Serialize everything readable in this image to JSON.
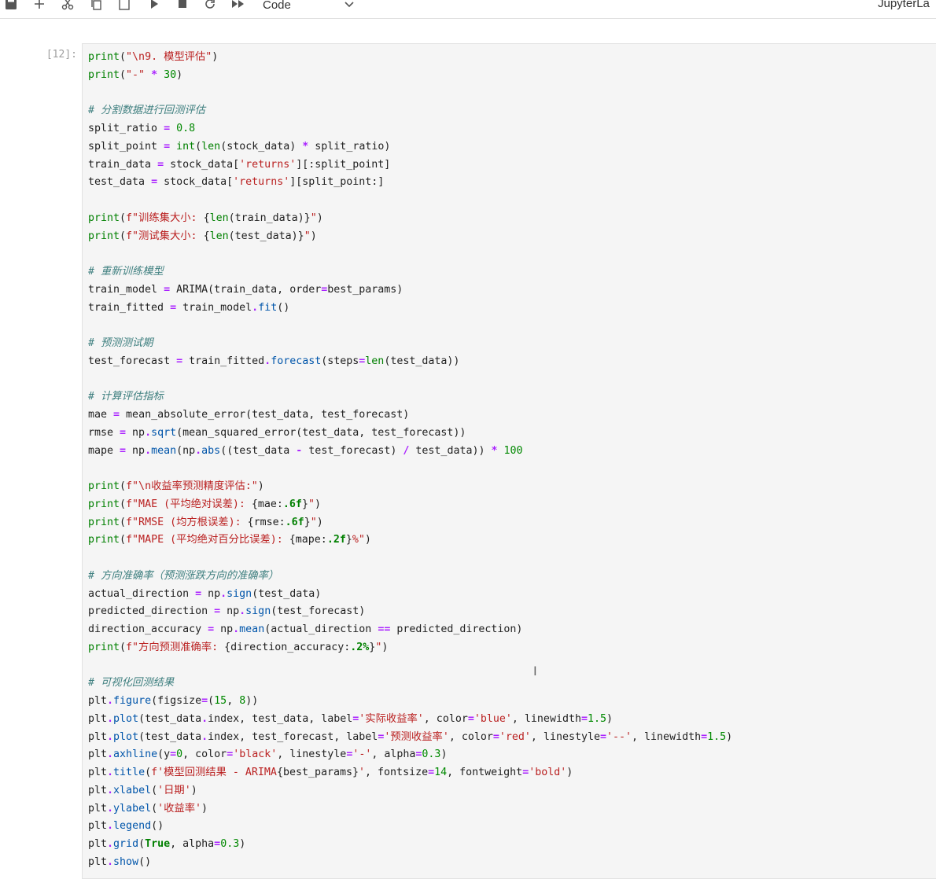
{
  "toolbar": {
    "cell_type": "Code",
    "brand": "JupyterLa"
  },
  "cell": {
    "prompt": "[12]:",
    "lines": [
      [
        [
          "k",
          "print"
        ],
        [
          "",
          "("
        ],
        [
          "s",
          "\"\\n9. 模型评估\""
        ],
        [
          "",
          ")"
        ]
      ],
      [
        [
          "k",
          "print"
        ],
        [
          "",
          "("
        ],
        [
          "s",
          "\"-\""
        ],
        [
          "",
          " "
        ],
        [
          "o",
          "*"
        ],
        [
          "",
          " "
        ],
        [
          "n",
          "30"
        ],
        [
          "",
          ")"
        ]
      ],
      [],
      [
        [
          "c",
          "# 分割数据进行回测评估"
        ]
      ],
      [
        [
          "",
          "split_ratio "
        ],
        [
          "o",
          "="
        ],
        [
          "",
          " "
        ],
        [
          "n",
          "0.8"
        ]
      ],
      [
        [
          "",
          "split_point "
        ],
        [
          "o",
          "="
        ],
        [
          "",
          " "
        ],
        [
          "k",
          "int"
        ],
        [
          "",
          "("
        ],
        [
          "k",
          "len"
        ],
        [
          "",
          "(stock_data) "
        ],
        [
          "o",
          "*"
        ],
        [
          "",
          " split_ratio)"
        ]
      ],
      [
        [
          "",
          "train_data "
        ],
        [
          "o",
          "="
        ],
        [
          "",
          " stock_data["
        ],
        [
          "s",
          "'returns'"
        ],
        [
          "",
          "][:split_point]"
        ]
      ],
      [
        [
          "",
          "test_data "
        ],
        [
          "o",
          "="
        ],
        [
          "",
          " stock_data["
        ],
        [
          "s",
          "'returns'"
        ],
        [
          "",
          "][split_point:]"
        ]
      ],
      [],
      [
        [
          "k",
          "print"
        ],
        [
          "",
          "("
        ],
        [
          "s",
          "f\"训练集大小: "
        ],
        [
          "",
          "{"
        ],
        [
          "k",
          "len"
        ],
        [
          "",
          "(train_data)}"
        ],
        [
          "s",
          "\""
        ],
        [
          "",
          ")"
        ]
      ],
      [
        [
          "k",
          "print"
        ],
        [
          "",
          "("
        ],
        [
          "s",
          "f\"测试集大小: "
        ],
        [
          "",
          "{"
        ],
        [
          "k",
          "len"
        ],
        [
          "",
          "(test_data)}"
        ],
        [
          "s",
          "\""
        ],
        [
          "",
          ")"
        ]
      ],
      [],
      [
        [
          "c",
          "# 重新训练模型"
        ]
      ],
      [
        [
          "",
          "train_model "
        ],
        [
          "o",
          "="
        ],
        [
          "",
          " ARIMA(train_data, order"
        ],
        [
          "o",
          "="
        ],
        [
          "",
          "best_params)"
        ]
      ],
      [
        [
          "",
          "train_fitted "
        ],
        [
          "o",
          "="
        ],
        [
          "",
          " train_model"
        ],
        [
          "o",
          "."
        ],
        [
          "a",
          "fit"
        ],
        [
          "",
          "()"
        ]
      ],
      [],
      [
        [
          "c",
          "# 预测测试期"
        ]
      ],
      [
        [
          "",
          "test_forecast "
        ],
        [
          "o",
          "="
        ],
        [
          "",
          " train_fitted"
        ],
        [
          "o",
          "."
        ],
        [
          "a",
          "forecast"
        ],
        [
          "",
          "(steps"
        ],
        [
          "o",
          "="
        ],
        [
          "k",
          "len"
        ],
        [
          "",
          "(test_data))"
        ]
      ],
      [],
      [
        [
          "c",
          "# 计算评估指标"
        ]
      ],
      [
        [
          "",
          "mae "
        ],
        [
          "o",
          "="
        ],
        [
          "",
          " mean_absolute_error(test_data, test_forecast)"
        ]
      ],
      [
        [
          "",
          "rmse "
        ],
        [
          "o",
          "="
        ],
        [
          "",
          " np"
        ],
        [
          "o",
          "."
        ],
        [
          "a",
          "sqrt"
        ],
        [
          "",
          "(mean_squared_error(test_data, test_forecast))"
        ]
      ],
      [
        [
          "",
          "mape "
        ],
        [
          "o",
          "="
        ],
        [
          "",
          " np"
        ],
        [
          "o",
          "."
        ],
        [
          "a",
          "mean"
        ],
        [
          "",
          "(np"
        ],
        [
          "o",
          "."
        ],
        [
          "a",
          "abs"
        ],
        [
          "",
          "((test_data "
        ],
        [
          "o",
          "-"
        ],
        [
          "",
          " test_forecast) "
        ],
        [
          "o",
          "/"
        ],
        [
          "",
          " test_data)) "
        ],
        [
          "o",
          "*"
        ],
        [
          "",
          " "
        ],
        [
          "n",
          "100"
        ]
      ],
      [],
      [
        [
          "k",
          "print"
        ],
        [
          "",
          "("
        ],
        [
          "s",
          "f\"\\n收益率预测精度评估:\""
        ],
        [
          "",
          ")"
        ]
      ],
      [
        [
          "k",
          "print"
        ],
        [
          "",
          "("
        ],
        [
          "s",
          "f\"MAE (平均绝对误差): "
        ],
        [
          "",
          "{mae:"
        ],
        [
          "b",
          ".6f"
        ],
        [
          "",
          "}"
        ],
        [
          "s",
          "\""
        ],
        [
          "",
          ")"
        ]
      ],
      [
        [
          "k",
          "print"
        ],
        [
          "",
          "("
        ],
        [
          "s",
          "f\"RMSE (均方根误差): "
        ],
        [
          "",
          "{rmse:"
        ],
        [
          "b",
          ".6f"
        ],
        [
          "",
          "}"
        ],
        [
          "s",
          "\""
        ],
        [
          "",
          ")"
        ]
      ],
      [
        [
          "k",
          "print"
        ],
        [
          "",
          "("
        ],
        [
          "s",
          "f\"MAPE (平均绝对百分比误差): "
        ],
        [
          "",
          "{mape:"
        ],
        [
          "b",
          ".2f"
        ],
        [
          "",
          "}"
        ],
        [
          "s",
          "%\""
        ],
        [
          "",
          ")"
        ]
      ],
      [],
      [
        [
          "c",
          "# 方向准确率（预测涨跌方向的准确率）"
        ]
      ],
      [
        [
          "",
          "actual_direction "
        ],
        [
          "o",
          "="
        ],
        [
          "",
          " np"
        ],
        [
          "o",
          "."
        ],
        [
          "a",
          "sign"
        ],
        [
          "",
          "(test_data)"
        ]
      ],
      [
        [
          "",
          "predicted_direction "
        ],
        [
          "o",
          "="
        ],
        [
          "",
          " np"
        ],
        [
          "o",
          "."
        ],
        [
          "a",
          "sign"
        ],
        [
          "",
          "(test_forecast)"
        ]
      ],
      [
        [
          "",
          "direction_accuracy "
        ],
        [
          "o",
          "="
        ],
        [
          "",
          " np"
        ],
        [
          "o",
          "."
        ],
        [
          "a",
          "mean"
        ],
        [
          "",
          "(actual_direction "
        ],
        [
          "o",
          "=="
        ],
        [
          "",
          " predicted_direction)"
        ]
      ],
      [
        [
          "k",
          "print"
        ],
        [
          "",
          "("
        ],
        [
          "s",
          "f\"方向预测准确率: "
        ],
        [
          "",
          "{direction_accuracy:"
        ],
        [
          "b",
          ".2%"
        ],
        [
          "",
          "}"
        ],
        [
          "s",
          "\""
        ],
        [
          "",
          ")"
        ]
      ],
      [],
      [
        [
          "c",
          "# 可视化回测结果"
        ]
      ],
      [
        [
          "",
          "plt"
        ],
        [
          "o",
          "."
        ],
        [
          "a",
          "figure"
        ],
        [
          "",
          "(figsize"
        ],
        [
          "o",
          "="
        ],
        [
          "",
          "("
        ],
        [
          "n",
          "15"
        ],
        [
          "",
          ", "
        ],
        [
          "n",
          "8"
        ],
        [
          "",
          "))"
        ]
      ],
      [
        [
          "",
          "plt"
        ],
        [
          "o",
          "."
        ],
        [
          "a",
          "plot"
        ],
        [
          "",
          "(test_data"
        ],
        [
          "o",
          "."
        ],
        [
          "",
          "index, test_data, label"
        ],
        [
          "o",
          "="
        ],
        [
          "s",
          "'实际收益率'"
        ],
        [
          "",
          ", color"
        ],
        [
          "o",
          "="
        ],
        [
          "s",
          "'blue'"
        ],
        [
          "",
          ", linewidth"
        ],
        [
          "o",
          "="
        ],
        [
          "n",
          "1.5"
        ],
        [
          "",
          ")"
        ]
      ],
      [
        [
          "",
          "plt"
        ],
        [
          "o",
          "."
        ],
        [
          "a",
          "plot"
        ],
        [
          "",
          "(test_data"
        ],
        [
          "o",
          "."
        ],
        [
          "",
          "index, test_forecast, label"
        ],
        [
          "o",
          "="
        ],
        [
          "s",
          "'预测收益率'"
        ],
        [
          "",
          ", color"
        ],
        [
          "o",
          "="
        ],
        [
          "s",
          "'red'"
        ],
        [
          "",
          ", linestyle"
        ],
        [
          "o",
          "="
        ],
        [
          "s",
          "'--'"
        ],
        [
          "",
          ", linewidth"
        ],
        [
          "o",
          "="
        ],
        [
          "n",
          "1.5"
        ],
        [
          "",
          ")"
        ]
      ],
      [
        [
          "",
          "plt"
        ],
        [
          "o",
          "."
        ],
        [
          "a",
          "axhline"
        ],
        [
          "",
          "(y"
        ],
        [
          "o",
          "="
        ],
        [
          "n",
          "0"
        ],
        [
          "",
          ", color"
        ],
        [
          "o",
          "="
        ],
        [
          "s",
          "'black'"
        ],
        [
          "",
          ", linestyle"
        ],
        [
          "o",
          "="
        ],
        [
          "s",
          "'-'"
        ],
        [
          "",
          ", alpha"
        ],
        [
          "o",
          "="
        ],
        [
          "n",
          "0.3"
        ],
        [
          "",
          ")"
        ]
      ],
      [
        [
          "",
          "plt"
        ],
        [
          "o",
          "."
        ],
        [
          "a",
          "title"
        ],
        [
          "",
          "("
        ],
        [
          "s",
          "f'模型回测结果 - ARIMA"
        ],
        [
          "",
          "{best_params}"
        ],
        [
          "s",
          "'"
        ],
        [
          "",
          ", fontsize"
        ],
        [
          "o",
          "="
        ],
        [
          "n",
          "14"
        ],
        [
          "",
          ", fontweight"
        ],
        [
          "o",
          "="
        ],
        [
          "s",
          "'bold'"
        ],
        [
          "",
          ")"
        ]
      ],
      [
        [
          "",
          "plt"
        ],
        [
          "o",
          "."
        ],
        [
          "a",
          "xlabel"
        ],
        [
          "",
          "("
        ],
        [
          "s",
          "'日期'"
        ],
        [
          "",
          ")"
        ]
      ],
      [
        [
          "",
          "plt"
        ],
        [
          "o",
          "."
        ],
        [
          "a",
          "ylabel"
        ],
        [
          "",
          "("
        ],
        [
          "s",
          "'收益率'"
        ],
        [
          "",
          ")"
        ]
      ],
      [
        [
          "",
          "plt"
        ],
        [
          "o",
          "."
        ],
        [
          "a",
          "legend"
        ],
        [
          "",
          "()"
        ]
      ],
      [
        [
          "",
          "plt"
        ],
        [
          "o",
          "."
        ],
        [
          "a",
          "grid"
        ],
        [
          "",
          "("
        ],
        [
          "b",
          "True"
        ],
        [
          "",
          ", alpha"
        ],
        [
          "o",
          "="
        ],
        [
          "n",
          "0.3"
        ],
        [
          "",
          ")"
        ]
      ],
      [
        [
          "",
          "plt"
        ],
        [
          "o",
          "."
        ],
        [
          "a",
          "show"
        ],
        [
          "",
          "()"
        ]
      ]
    ]
  }
}
